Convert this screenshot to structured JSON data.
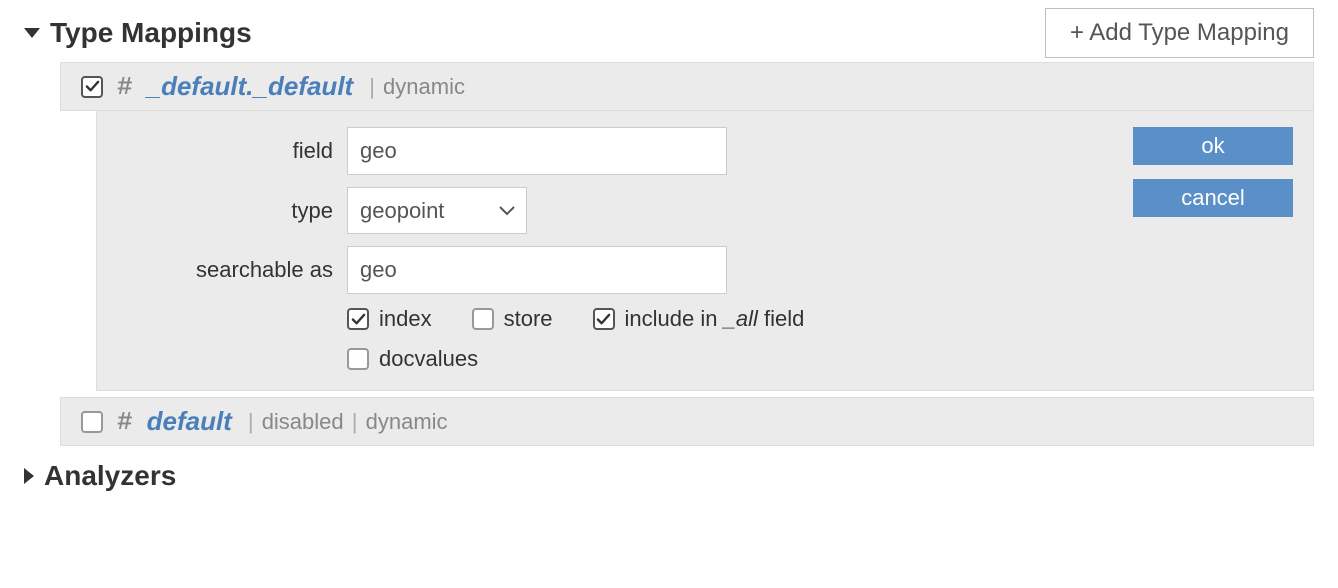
{
  "typeMappings": {
    "title": "Type Mappings",
    "addButton": "+ Add Type Mapping",
    "items": [
      {
        "checked": true,
        "name": "_default._default",
        "meta": [
          "dynamic"
        ],
        "expanded": true,
        "form": {
          "labels": {
            "field": "field",
            "type": "type",
            "searchableAs": "searchable as"
          },
          "fieldValue": "geo",
          "typeValue": "geopoint",
          "searchableAsValue": "geo",
          "checkboxes": {
            "index": {
              "label": "index",
              "checked": true
            },
            "store": {
              "label": "store",
              "checked": false
            },
            "includeInAll": {
              "prefix": "include in ",
              "italic": "_all",
              "suffix": " field",
              "checked": true
            },
            "docvalues": {
              "label": "docvalues",
              "checked": false
            }
          },
          "buttons": {
            "ok": "ok",
            "cancel": "cancel"
          }
        }
      },
      {
        "checked": false,
        "name": "default",
        "meta": [
          "disabled",
          "dynamic"
        ]
      }
    ]
  },
  "analyzers": {
    "title": "Analyzers"
  }
}
